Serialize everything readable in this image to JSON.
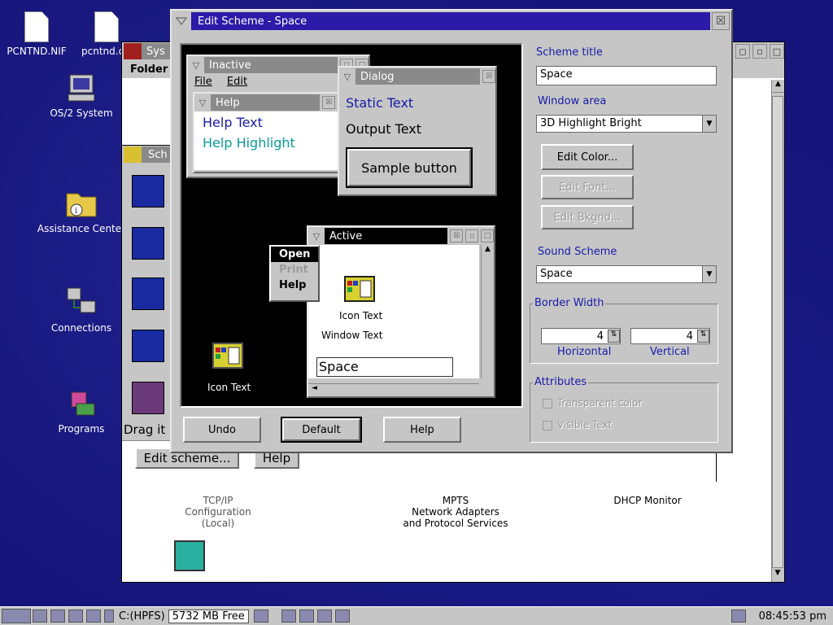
{
  "desktop": {
    "icons": [
      {
        "label": "PCNTND.NIF",
        "icon": "document-icon"
      },
      {
        "label": "pcntnd.c",
        "icon": "document-icon"
      },
      {
        "label": "OS/2 System",
        "icon": "computer-icon"
      },
      {
        "label": "Assistance Center",
        "icon": "info-folder-icon"
      },
      {
        "label": "Connections",
        "icon": "network-icon"
      },
      {
        "label": "Programs",
        "icon": "programs-icon"
      }
    ]
  },
  "system_window": {
    "title": "Sys",
    "menu_folder": "Folder",
    "scheme_title": "Sch",
    "drag_text": "Drag it",
    "edit_scheme_button": "Edit scheme...",
    "help_button": "Help",
    "items": [
      {
        "label": "TCP/IP\nConfiguration\n(Local)"
      },
      {
        "label": "MPTS\nNetwork Adapters\nand Protocol Services"
      },
      {
        "label": "DHCP Monitor"
      }
    ]
  },
  "edit_scheme": {
    "title": "Edit Scheme - Space",
    "preview": {
      "inactive_title": "Inactive",
      "menu_file": "File",
      "menu_edit": "Edit",
      "help_title": "Help",
      "help_text": "Help Text",
      "help_highlight": "Help Highlight",
      "dialog_title": "Dialog",
      "static_text": "Static Text",
      "output_text": "Output Text",
      "sample_button": "Sample button",
      "active_title": "Active",
      "popup_open": "Open",
      "popup_print": "Print",
      "popup_help": "Help",
      "icon_text_inner": "Icon Text",
      "window_text": "Window Text",
      "entry_value": "Space",
      "icon_text_outer": "Icon Text"
    },
    "buttons": {
      "undo": "Undo",
      "default": "Default",
      "help": "Help"
    },
    "scheme_title_label": "Scheme title",
    "scheme_title_value": "Space",
    "window_area_label": "Window area",
    "window_area_value": "3D Highlight Bright",
    "edit_color": "Edit Color...",
    "edit_font": "Edit Font...",
    "edit_bkgnd": "Edit Bkgnd...",
    "sound_scheme_label": "Sound Scheme",
    "sound_scheme_value": "Space",
    "border_width_label": "Border Width",
    "horizontal_value": "4",
    "horizontal_label": "Horizontal",
    "vertical_value": "4",
    "vertical_label": "Vertical",
    "attributes_label": "Attributes",
    "transparent_color": "Transparent color",
    "visible_text": "Visible Text"
  },
  "taskbar": {
    "drive": "C:(HPFS)",
    "free_space": "5732 MB Free",
    "clock": "08:45:53 pm"
  },
  "colors": {
    "desktop": "#14147a",
    "title_active": "#2c1ba8",
    "title_inactive": "#8a8a8a",
    "help_text": "#1a1aa8",
    "help_highlight": "#0a9a9a"
  }
}
